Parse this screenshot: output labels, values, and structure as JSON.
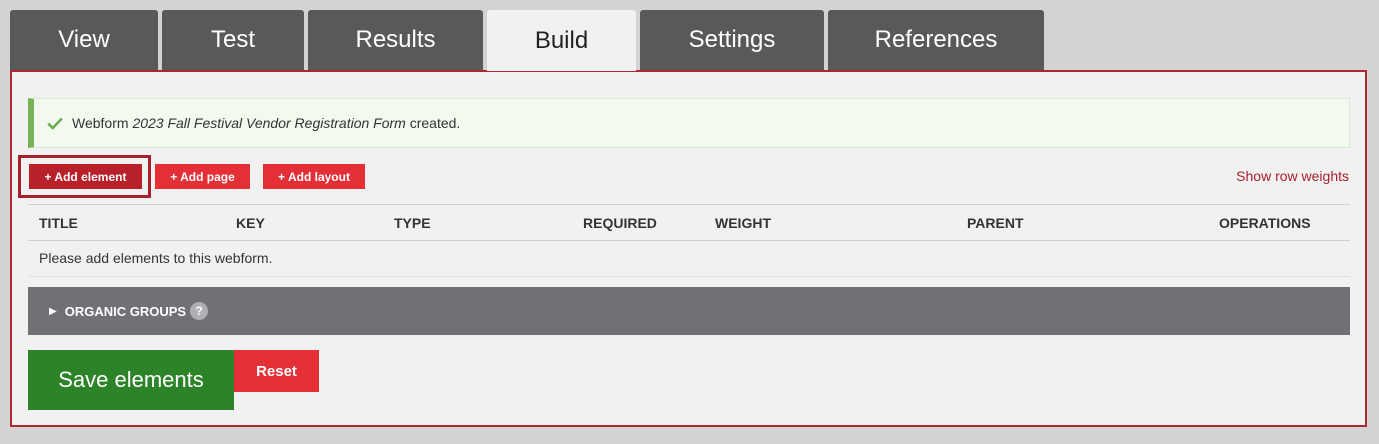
{
  "tabs": [
    {
      "label": "View"
    },
    {
      "label": "Test"
    },
    {
      "label": "Results"
    },
    {
      "label": "Build"
    },
    {
      "label": "Settings"
    },
    {
      "label": "References"
    }
  ],
  "message": {
    "prefix": "Webform",
    "form_name": "2023 Fall Festival Vendor Registration Form",
    "suffix": "created.",
    "icon": "checkmark-icon"
  },
  "actions": {
    "add_element": "+ Add element",
    "add_page": "+ Add page",
    "add_layout": "+ Add layout",
    "show_row_weights": "Show row weights"
  },
  "table": {
    "columns": [
      "TITLE",
      "KEY",
      "TYPE",
      "REQUIRED",
      "WEIGHT",
      "PARENT",
      "OPERATIONS"
    ],
    "empty_text": "Please add elements to this webform."
  },
  "organic_groups": {
    "label": "ORGANIC GROUPS",
    "help": "?"
  },
  "buttons": {
    "save": "Save elements",
    "reset": "Reset"
  },
  "colors": {
    "accent": "#b0282f",
    "button_red": "#e42f36",
    "save_green": "#2c8328",
    "tab_dark": "#58595b"
  }
}
